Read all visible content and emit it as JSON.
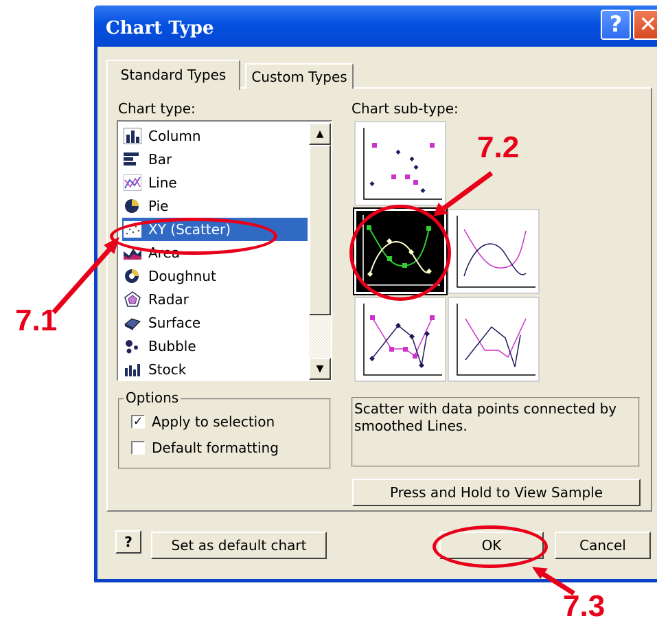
{
  "dialog": {
    "title": "Chart Type",
    "help_glyph": "?",
    "close_glyph": "✕"
  },
  "tabs": [
    {
      "label": "Standard Types",
      "active": true
    },
    {
      "label": "Custom Types",
      "active": false
    }
  ],
  "chart_type": {
    "label": "Chart type:",
    "items": [
      {
        "label": "Column",
        "icon": "column-chart-icon"
      },
      {
        "label": "Bar",
        "icon": "bar-chart-icon"
      },
      {
        "label": "Line",
        "icon": "line-chart-icon"
      },
      {
        "label": "Pie",
        "icon": "pie-chart-icon"
      },
      {
        "label": "XY (Scatter)",
        "icon": "scatter-chart-icon",
        "selected": true
      },
      {
        "label": "Area",
        "icon": "area-chart-icon"
      },
      {
        "label": "Doughnut",
        "icon": "doughnut-chart-icon"
      },
      {
        "label": "Radar",
        "icon": "radar-chart-icon"
      },
      {
        "label": "Surface",
        "icon": "surface-chart-icon"
      },
      {
        "label": "Bubble",
        "icon": "bubble-chart-icon"
      },
      {
        "label": "Stock",
        "icon": "stock-chart-icon"
      }
    ]
  },
  "subtype": {
    "label": "Chart sub-type:",
    "selected_index": 1,
    "description": "Scatter with data points connected by smoothed Lines."
  },
  "options": {
    "title": "Options",
    "apply_to_selection": {
      "label": "Apply to selection",
      "checked": true
    },
    "default_formatting": {
      "label": "Default formatting",
      "checked": false
    }
  },
  "buttons": {
    "press_hold": "Press and Hold to View Sample",
    "help_icon": "?",
    "set_default": "Set as default chart",
    "ok": "OK",
    "cancel": "Cancel"
  },
  "annotations": {
    "step1": "7.1",
    "step2": "7.2",
    "step3": "7.3"
  },
  "colors": {
    "annotation_red": "#e8001a",
    "selection_blue": "#316ac5",
    "titlebar_blue": "#0550e0"
  }
}
